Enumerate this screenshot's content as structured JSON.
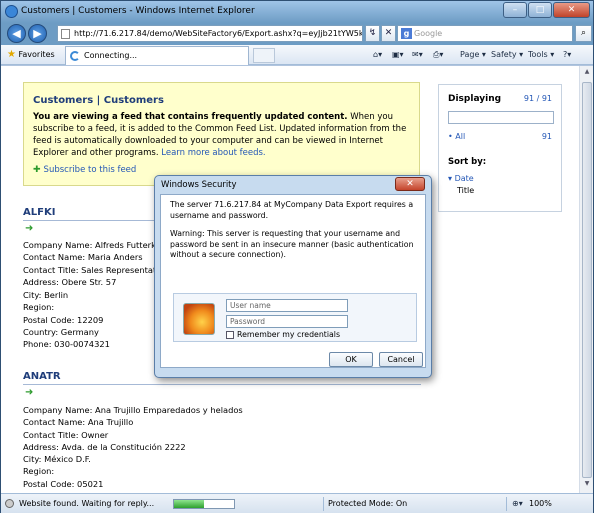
{
  "window": {
    "title": "Customers | Customers - Windows Internet Explorer"
  },
  "address": {
    "url": "http://71.6.217.84/demo/WebSiteFactory6/Export.ashx?q=eyJjb21tYW5kTmFtZSI6IkV"
  },
  "search": {
    "placeholder": "Google",
    "engine_letter": "g"
  },
  "favorites": {
    "label": "Favorites"
  },
  "tab": {
    "label": "Connecting..."
  },
  "commandbar": {
    "page": "Page ▾",
    "safety": "Safety ▾",
    "tools": "Tools ▾",
    "help": "?▾"
  },
  "banner": {
    "title": "Customers | Customers",
    "bold": "You are viewing a feed that contains frequently updated content.",
    "text": " When you subscribe to a feed, it is added to the Common Feed List. Updated information from the feed is automatically downloaded to your computer and can be viewed in Internet Explorer and other programs.",
    "link": "Learn more about feeds.",
    "subscribe": "Subscribe to this feed"
  },
  "sidebar": {
    "displaying": "Displaying",
    "count": "91 / 91",
    "all": "All",
    "all_count": "91",
    "sort_by": "Sort by:",
    "date": "Date",
    "title": "Title"
  },
  "entries": [
    {
      "heading": "ALFKI",
      "lines": [
        "Company Name: Alfreds Futterkiste",
        "Contact Name: Maria Anders",
        "Contact Title: Sales Representative",
        "Address: Obere Str. 57",
        "City: Berlin",
        "Region:",
        "Postal Code: 12209",
        "Country: Germany",
        "Phone: 030-0074321"
      ]
    },
    {
      "heading": "ANATR",
      "lines": [
        "Company Name: Ana Trujillo Emparedados y helados",
        "Contact Name: Ana Trujillo",
        "Contact Title: Owner",
        "Address: Avda. de la Constitución 2222",
        "City: México D.F.",
        "Region:",
        "Postal Code: 05021"
      ]
    }
  ],
  "status": {
    "text": "Website found. Waiting for reply...",
    "progress": 0.5,
    "protected_mode": "Protected Mode: On",
    "zoom": "100%"
  },
  "dialog": {
    "title": "Windows Security",
    "message1": "The server 71.6.217.84 at MyCompany Data Export requires a username and password.",
    "message2": "Warning: This server is requesting that your username and password be sent in an insecure manner (basic authentication without a secure connection).",
    "username_placeholder": "User name",
    "password_placeholder": "Password",
    "remember": "Remember my credentials",
    "ok": "OK",
    "cancel": "Cancel"
  },
  "colors": {
    "accent": "#1f3d7a",
    "link": "#2457b6",
    "banner_bg": "#ffffcc"
  }
}
